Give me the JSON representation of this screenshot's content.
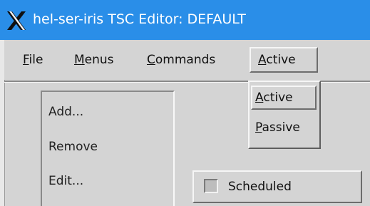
{
  "window": {
    "title": "hel-ser-iris  TSC Editor: DEFAULT",
    "titlebar_color": "#2a8ee8",
    "app_icon": "x-window-system-icon"
  },
  "menubar": {
    "file": {
      "mnemonic": "F",
      "rest": "ile"
    },
    "menus": {
      "mnemonic": "M",
      "rest": "enus"
    },
    "commands": {
      "mnemonic": "C",
      "rest": "ommands"
    },
    "active": {
      "mnemonic": "A",
      "rest": "ctive"
    }
  },
  "active_menu": {
    "items": [
      {
        "mnemonic": "A",
        "rest": "ctive"
      },
      {
        "mnemonic": "P",
        "rest": "assive"
      }
    ]
  },
  "panel": {
    "add": "Add...",
    "remove": "Remove",
    "edit": "Edit..."
  },
  "scheduled": {
    "label": "Scheduled",
    "checked": false
  }
}
